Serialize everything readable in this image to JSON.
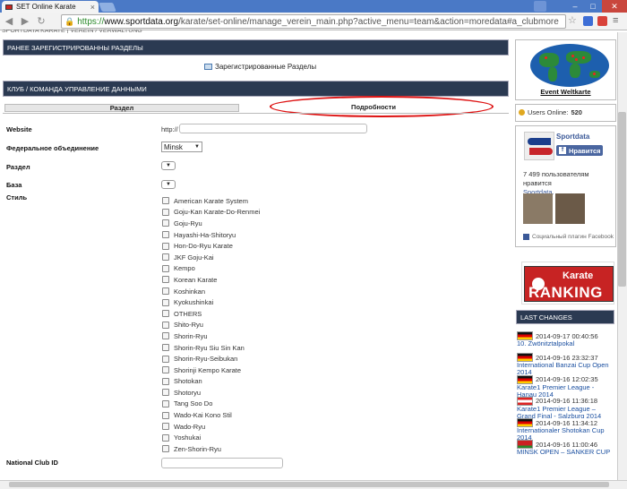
{
  "browser": {
    "tab_title": "SET Online Karate",
    "url_scheme": "https://",
    "url_domain": "www.sportdata.org",
    "url_path": "/karate/set-online/manage_verein_main.php?active_menu=team&action=moredata#a_clubmore"
  },
  "page": {
    "cut_heading": "SPORTDATA KARATE | VEREIN / VERWALTUNG",
    "registered_section": {
      "header": "РАНЕЕ ЗАРЕГИСТРИРОВАННЫ РАЗДЕЛЫ",
      "link": "Зарегистрированные Разделы"
    },
    "club_section": {
      "header": "КЛУБ / КОМАНДА УПРАВЛЕНИЕ ДАННЫМИ",
      "tabs": [
        "Раздел",
        "Подробности"
      ]
    },
    "form": {
      "website_label": "Website",
      "website_prefix": "http://",
      "federation_label": "Федеральное объединение",
      "federation_value": "Minsk",
      "section_label": "Раздел",
      "base_label": "База",
      "style_label": "Стиль",
      "styles": [
        "American Karate System",
        "Goju-Kan Karate-Do-Renmei",
        "Goju-Ryu",
        "Hayashi-Ha-Shitoryu",
        "Hon-Do-Ryu Karate",
        "JKF Goju-Kai",
        "Kempo",
        "Korean Karate",
        "Koshinkan",
        "Kyokushinkai",
        "OTHERS",
        "Shito-Ryu",
        "Shorin-Ryu",
        "Shorin-Ryu Siu Sin Kan",
        "Shorin-Ryu-Seibukan",
        "Shorinji Kempo Karate",
        "Shotokan",
        "Shotoryu",
        "Tang Soo Do",
        "Wado-Kai Kono Stil",
        "Wado-Ryu",
        "Yoshukai",
        "Zen-Shorin-Ryu"
      ],
      "club_id_label": "National Club ID"
    }
  },
  "sidebar": {
    "event_map_label": "Event Weltkarte",
    "online_label": "Users Online:",
    "online_count": "520",
    "fb_name": "Sportdata",
    "fb_like": "Нравится",
    "fb_count_text": "7 499 пользователям нравится",
    "fb_count_link": "Sportdata.",
    "fb_plugin": "Социальный плагин Facebook",
    "ranking_top": "Karate",
    "ranking_bottom": "RANKING",
    "last_changes_header": "LAST CHANGES",
    "last_changes": [
      {
        "flag": "de",
        "date": "2014-09-17 00:40:56",
        "title": "10. Zwönitztalpokal"
      },
      {
        "flag": "de",
        "date": "2014-09-16 23:32:37",
        "title": "International Banzai Cup Open 2014"
      },
      {
        "flag": "de",
        "date": "2014-09-16 12:02:35",
        "title": "Karate1 Premier League - Hanau 2014"
      },
      {
        "flag": "at",
        "date": "2014-09-16 11:36:18",
        "title": "Karate1 Premier League – Grand Final - Salzburg 2014"
      },
      {
        "flag": "de",
        "date": "2014-09-16 11:34:12",
        "title": "Internationaler Shotokan Cup 2014"
      },
      {
        "flag": "by",
        "date": "2014-09-16 11:00:46",
        "title": "MINSK OPEN – SANKER CUP"
      }
    ]
  },
  "colors": {
    "panel_header": "#2b3a52",
    "highlight_ellipse": "#dd1111",
    "facebook_blue": "#3b5998",
    "ranking_red": "#c72323"
  },
  "icons": [
    "back-icon",
    "forward-icon",
    "reload-icon",
    "lock-icon",
    "star-icon",
    "menu-icon",
    "close-icon",
    "user-icon",
    "dropdown-arrow-icon",
    "flag-icon"
  ]
}
